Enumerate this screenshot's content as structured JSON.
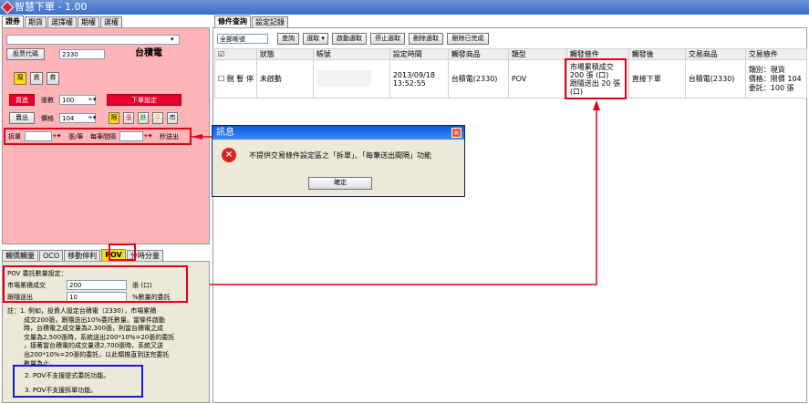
{
  "window": {
    "title": "智慧下單 - 1.00"
  },
  "left_tabs": [
    "證券",
    "期貨",
    "選擇權",
    "期權",
    "選權"
  ],
  "left_active_tab": 0,
  "stock": {
    "code_button": "股票代碼",
    "code": "2330",
    "name": "台積電"
  },
  "mode_buttons": [
    "現",
    "資",
    "券"
  ],
  "order": {
    "buy": "買進",
    "qty_label": "張數",
    "qty": "100",
    "trigger": "下單設定",
    "sell": "賣出",
    "price_label": "價格",
    "price": "104",
    "price_buttons": [
      "限",
      "漲",
      "跌",
      "平",
      "市"
    ]
  },
  "split": {
    "label": "拆單",
    "unit": "張/筆",
    "interval_label": "每筆間隔",
    "interval_unit": "秒送出"
  },
  "right_tabs": [
    "條件查詢",
    "設定記錄"
  ],
  "right_active_tab": 0,
  "toolbar": {
    "account_select": "全部帳號",
    "buttons": [
      "查詢",
      "選取 ▾",
      "啟動選取",
      "停止選取",
      "刪除選取",
      "刪除已完成"
    ]
  },
  "table": {
    "headers": [
      "狀態",
      "帳號",
      "設定時間",
      "觸發商品",
      "類型",
      "觸發條件",
      "觸發後",
      "交易商品",
      "交易條件"
    ],
    "row": {
      "actions": [
        "刪",
        "暫",
        "停"
      ],
      "status": "未啟動",
      "time1": "2013/09/18",
      "time2": "13:52:55",
      "product": "台積電(2330)",
      "type": "POV",
      "cond1": "市場累積成交",
      "cond2": "200 張 (口)",
      "cond3": "跟隨送出 20 張",
      "cond4": "(口)",
      "after": "直接下單",
      "trade_product": "台積電(2330)",
      "trade1": "類別：現貨",
      "trade2": "價格：限價 104",
      "trade3": "委託：100 張"
    }
  },
  "dialog": {
    "title": "訊息",
    "message": "不提供交易條件設定區之「拆單」、「每筆送出間隔」功能",
    "ok": "確定"
  },
  "bottom_tabs": [
    "觸價觸量",
    "OCO",
    "移動停利",
    "POV",
    "分時分量"
  ],
  "bottom_active_tab": 3,
  "pov": {
    "title": "POV 委託數量設定：",
    "row1_label": "市場累積成交",
    "row1_value": "200",
    "row1_unit": "張 (口)",
    "row2_label": "跟隨送出",
    "row2_value": "10",
    "row2_unit": "%數量的委託",
    "note1_l1": "註：1. 例如，投資人設定台積電（2330），市場累積",
    "note1_l2": "成交200張，跟隨送出10%委託數量。當條件啟動",
    "note1_l3": "時，台積電之成交量為2,300張，則當台積電之成",
    "note1_l4": "交量為2,500張時，系統送出200*10%=20張的委託",
    "note1_l5": "，接著當台積電的成交量達2,700張時，系統又送",
    "note1_l6": "出200*10%=20張的委託，以此類推直到送完委託",
    "note1_l7": "數量為止。",
    "note2": "2. POV不支援提式委託功能。",
    "note3": "3. POV不支援拆單功能。"
  },
  "colors": {
    "accent_red": "#e2001a",
    "note_blue": "#1a1ad0",
    "left_bg": "#ffb5b8"
  }
}
